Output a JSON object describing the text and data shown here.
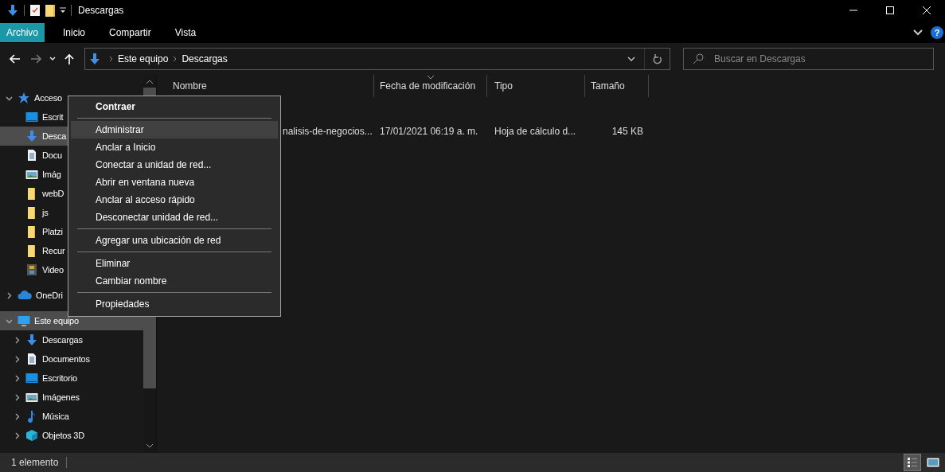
{
  "window": {
    "title": "Descargas"
  },
  "ribbon": {
    "tabs": [
      {
        "label": "Archivo",
        "selected": true
      },
      {
        "label": "Inicio",
        "selected": false
      },
      {
        "label": "Compartir",
        "selected": false
      },
      {
        "label": "Vista",
        "selected": false
      }
    ]
  },
  "help_button": {
    "label": "?"
  },
  "navigation": {
    "back_disabled": false,
    "forward_disabled": true
  },
  "address_bar": {
    "path": [
      "Este equipo",
      "Descargas"
    ]
  },
  "search": {
    "placeholder": "Buscar en Descargas"
  },
  "sidebar": {
    "items": [
      {
        "label": "Acceso",
        "kind": "star",
        "expanded": true,
        "selected": false,
        "children": [
          {
            "label": "Escrit",
            "kind": "desktop",
            "selected": false
          },
          {
            "label": "Desca",
            "kind": "download",
            "selected": true
          },
          {
            "label": "Docu",
            "kind": "document",
            "selected": false
          },
          {
            "label": "Imág",
            "kind": "pictures",
            "selected": false
          },
          {
            "label": "webD",
            "kind": "folder",
            "selected": false
          },
          {
            "label": "js",
            "kind": "folder",
            "selected": false
          },
          {
            "label": "Platzi",
            "kind": "folder",
            "selected": false
          },
          {
            "label": "Recur",
            "kind": "folder",
            "selected": false
          },
          {
            "label": "Video",
            "kind": "video",
            "selected": false
          }
        ]
      },
      {
        "label": "OneDri",
        "kind": "cloud",
        "expanded": false,
        "selected": false
      },
      {
        "label": "Este equipo",
        "kind": "computer",
        "expanded": true,
        "selected": true,
        "children": [
          {
            "label": "Descargas",
            "kind": "download",
            "expanded": false,
            "selected": false
          },
          {
            "label": "Documentos",
            "kind": "document",
            "expanded": false,
            "selected": false
          },
          {
            "label": "Escritorio",
            "kind": "desktop",
            "expanded": false,
            "selected": false
          },
          {
            "label": "Imágenes",
            "kind": "pictures",
            "expanded": false,
            "selected": false
          },
          {
            "label": "Música",
            "kind": "music",
            "expanded": false,
            "selected": false
          },
          {
            "label": "Objetos 3D",
            "kind": "cube",
            "expanded": false,
            "selected": false
          }
        ]
      }
    ]
  },
  "table": {
    "columns": [
      {
        "label": "Nombre",
        "sorted": false
      },
      {
        "label": "Fecha de modificación",
        "sorted": true
      },
      {
        "label": "Tipo",
        "sorted": false
      },
      {
        "label": "Tamaño",
        "sorted": false
      }
    ],
    "rows": [
      {
        "name": "nalisis-de-negocios...",
        "modified": "17/01/2021 06:19 a. m.",
        "type": "Hoja de cálculo d...",
        "size": "145 KB"
      }
    ]
  },
  "context_menu": {
    "items": [
      {
        "kind": "default",
        "label": "Contraer",
        "selected": false
      },
      {
        "kind": "separator"
      },
      {
        "kind": "item",
        "label": "Administrar",
        "selected": true
      },
      {
        "kind": "item",
        "label": "Anclar a Inicio",
        "selected": false
      },
      {
        "kind": "item",
        "label": "Conectar a unidad de red...",
        "selected": false
      },
      {
        "kind": "item",
        "label": "Abrir en ventana nueva",
        "selected": false
      },
      {
        "kind": "item",
        "label": "Anclar al acceso rápido",
        "selected": false
      },
      {
        "kind": "item",
        "label": "Desconectar unidad de red...",
        "selected": false
      },
      {
        "kind": "separator"
      },
      {
        "kind": "item",
        "label": "Agregar una ubicación de red",
        "selected": false
      },
      {
        "kind": "separator"
      },
      {
        "kind": "item",
        "label": "Eliminar",
        "selected": false
      },
      {
        "kind": "item",
        "label": "Cambiar nombre",
        "selected": false
      },
      {
        "kind": "separator"
      },
      {
        "kind": "item",
        "label": "Propiedades",
        "selected": false
      }
    ]
  },
  "status_bar": {
    "text": "1 elemento",
    "views": [
      {
        "kind": "details",
        "selected": true
      },
      {
        "kind": "large_icons",
        "selected": false
      }
    ]
  }
}
